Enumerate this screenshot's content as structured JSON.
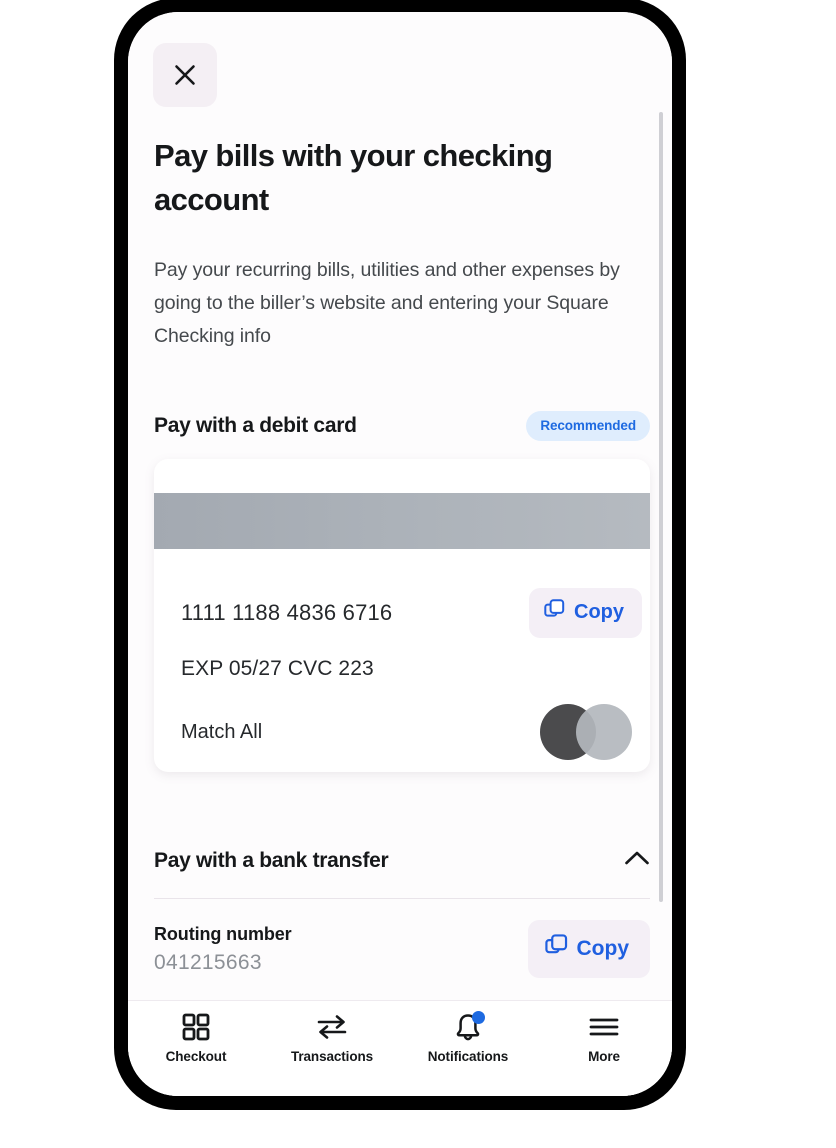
{
  "screen": {
    "close_icon": "close-icon",
    "title": "Pay bills with your checking account",
    "subtitle": "Pay your recurring bills, utilities and other expenses by going to the biller’s website and entering your Square Checking info"
  },
  "debit_section": {
    "title": "Pay with a debit card",
    "badge": "Recommended",
    "badge_bg": "#dfedfd",
    "badge_color": "#1e6ae1",
    "card": {
      "number": "1111 1188 4836 6716",
      "expiry_cvc": "EXP 05/27  CVC 223",
      "brand_name": "Match All",
      "brand_logo_icon": "mastercard-circles-icon",
      "magstripe_color": "#adb3ba",
      "copy_button": {
        "label": "Copy",
        "icon": "copy-icon"
      }
    }
  },
  "bank_section": {
    "title": "Pay with a bank transfer",
    "collapse_icon": "chevron-up-icon",
    "routing": {
      "label": "Routing number",
      "value": "041215663",
      "copy_button": {
        "label": "Copy",
        "icon": "copy-icon"
      }
    }
  },
  "bottom_nav": {
    "items": [
      {
        "label": "Checkout",
        "icon": "grid-icon",
        "badge": false
      },
      {
        "label": "Transactions",
        "icon": "transfer-arrows-icon",
        "badge": false
      },
      {
        "label": "Notifications",
        "icon": "bell-icon",
        "badge": true
      },
      {
        "label": "More",
        "icon": "hamburger-menu-icon",
        "badge": false
      }
    ],
    "badge_color": "#1e6ae1"
  },
  "accent_color": "#1f5fe0"
}
